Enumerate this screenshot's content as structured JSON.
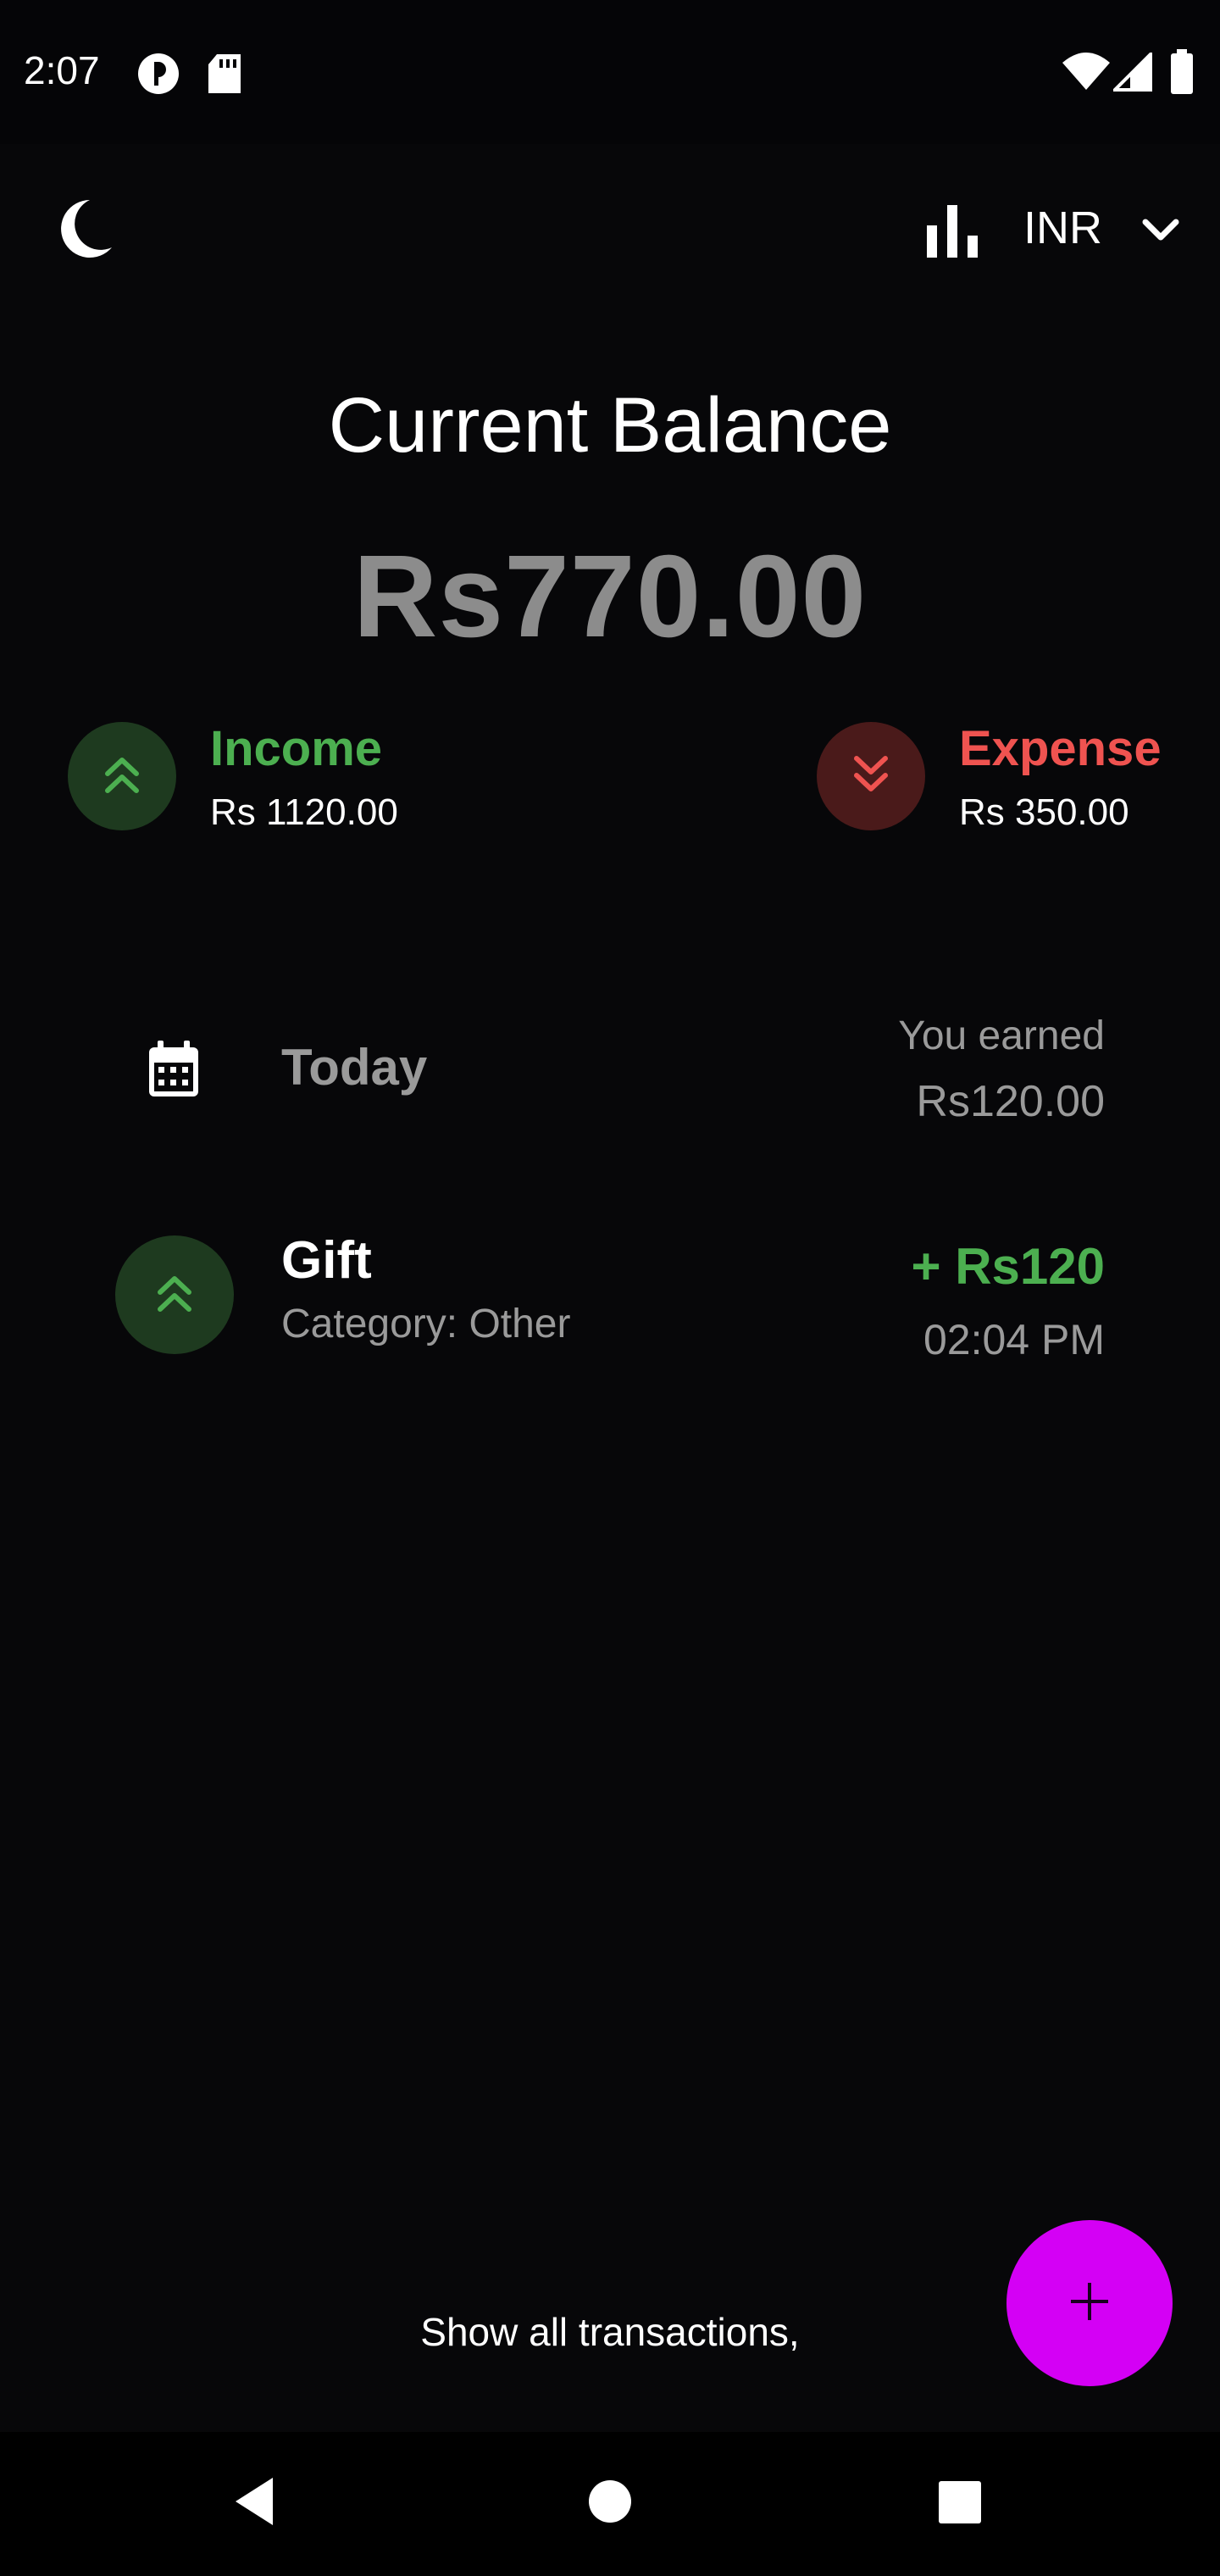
{
  "status_bar": {
    "time": "2:07",
    "icons": [
      "circle-p-icon",
      "sd-card-icon",
      "wifi-icon",
      "cellular-signal-icon",
      "battery-icon"
    ]
  },
  "top_bar": {
    "theme_icon": "moon-icon",
    "stats_icon": "bar-chart-icon",
    "currency": "INR",
    "dropdown_icon": "chevron-down-icon"
  },
  "balance": {
    "title": "Current Balance",
    "amount": "Rs770.00"
  },
  "summary": {
    "income_label": "Income",
    "income_value": "Rs 1120.00",
    "expense_label": "Expense",
    "expense_value": "Rs 350.00"
  },
  "today": {
    "label": "Today",
    "earned_label": "You earned",
    "earned_value": "Rs120.00"
  },
  "transactions": [
    {
      "title": "Gift",
      "category": "Category: Other",
      "amount": "+ Rs120",
      "time": "02:04 PM",
      "type": "income"
    }
  ],
  "footer": {
    "show_all": "Show all transactions,",
    "fab_icon": "plus-icon"
  },
  "colors": {
    "background": "#070709",
    "income": "#4caf50",
    "expense": "#ef5350",
    "income_circle": "#1e3a1f",
    "expense_circle": "#4a1a1a",
    "fab": "#d400f5",
    "muted_text": "#9a9a9a"
  }
}
